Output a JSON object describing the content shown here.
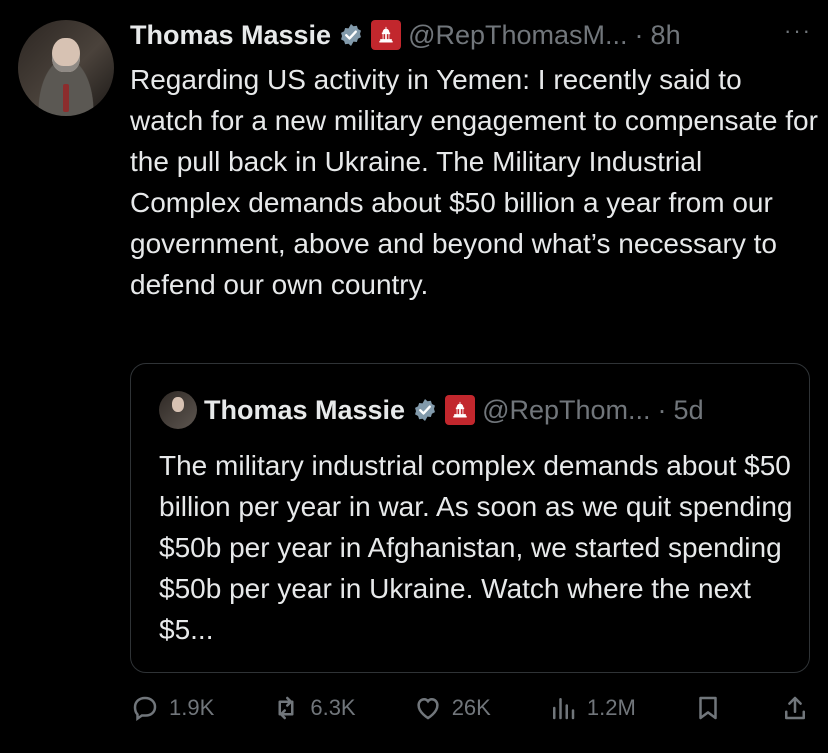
{
  "tweet": {
    "author_name": "Thomas Massie",
    "author_handle": "@RepThomasM...",
    "separator": "·",
    "time": "8h",
    "more_label": "···",
    "text": "Regarding US activity in Yemen: I recently said to watch for a new military engagement to compensate for the pull back in Ukraine. The Military Industrial Complex demands about $50 billion a year from our government, above and beyond what’s necessary to defend our own country."
  },
  "quote": {
    "author_name": "Thomas Massie",
    "author_handle": "@RepThom...",
    "separator": "·",
    "time": "5d",
    "text": "The military industrial complex demands about $50 billion per year in war. As soon as we quit spending $50b per year in Afghanistan, we started spending $50b per year in Ukraine. Watch where the next $5..."
  },
  "actions": {
    "replies": "1.9K",
    "reposts": "6.3K",
    "likes": "26K",
    "views": "1.2M"
  },
  "colors": {
    "background": "#000000",
    "text": "#e7e9ea",
    "muted": "#71767b",
    "verified": "#829aab",
    "affiliation": "#c2272d",
    "border": "#2f3336"
  },
  "icons": [
    "reply-icon",
    "repost-icon",
    "like-icon",
    "views-icon",
    "bookmark-icon",
    "share-icon",
    "verified-icon",
    "capitol-icon"
  ]
}
